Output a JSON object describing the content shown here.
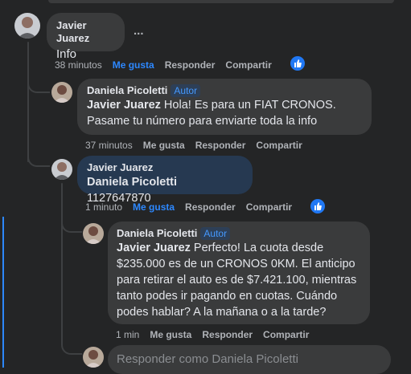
{
  "comments": [
    {
      "author": "Javier Juarez",
      "text": "Info",
      "actions": {
        "time": "38 minutos",
        "like": "Me gusta",
        "reply": "Responder",
        "share": "Compartir"
      },
      "more": "..."
    },
    {
      "author": "Daniela Picoletti",
      "badge": "Autor",
      "mention": "Javier Juarez",
      "text_line1": " Hola! Es para un FIAT CRONOS.",
      "text_line2": "Pasame tu número para enviarte toda la info",
      "actions": {
        "time": "37 minutos",
        "like": "Me gusta",
        "reply": "Responder",
        "share": "Compartir"
      }
    },
    {
      "author": "Javier Juarez",
      "mention": "Daniela Picoletti",
      "text": " 1127647870",
      "actions": {
        "time": "1 minuto",
        "like": "Me gusta",
        "reply": "Responder",
        "share": "Compartir"
      }
    },
    {
      "author": "Daniela Picoletti",
      "badge": "Autor",
      "mention": "Javier Juarez",
      "lines": [
        " Perfecto! La cuota desde",
        "$235.000 es de un CRONOS 0KM. El anticipo",
        "para retirar el auto es de $7.421.100, mientras",
        "tanto podes ir pagando en cuotas. Cuándo",
        "podes hablar? A la mañana o a la tarde?"
      ],
      "actions": {
        "time": "1 min",
        "like": "Me gusta",
        "reply": "Responder",
        "share": "Compartir"
      }
    }
  ],
  "reply_box": {
    "placeholder": "Responder como Daniela Picoletti"
  },
  "colors": {
    "background": "#242526",
    "bubble": "#3a3b3c",
    "highlight_bubble": "#263951",
    "accent": "#2d88ff"
  }
}
